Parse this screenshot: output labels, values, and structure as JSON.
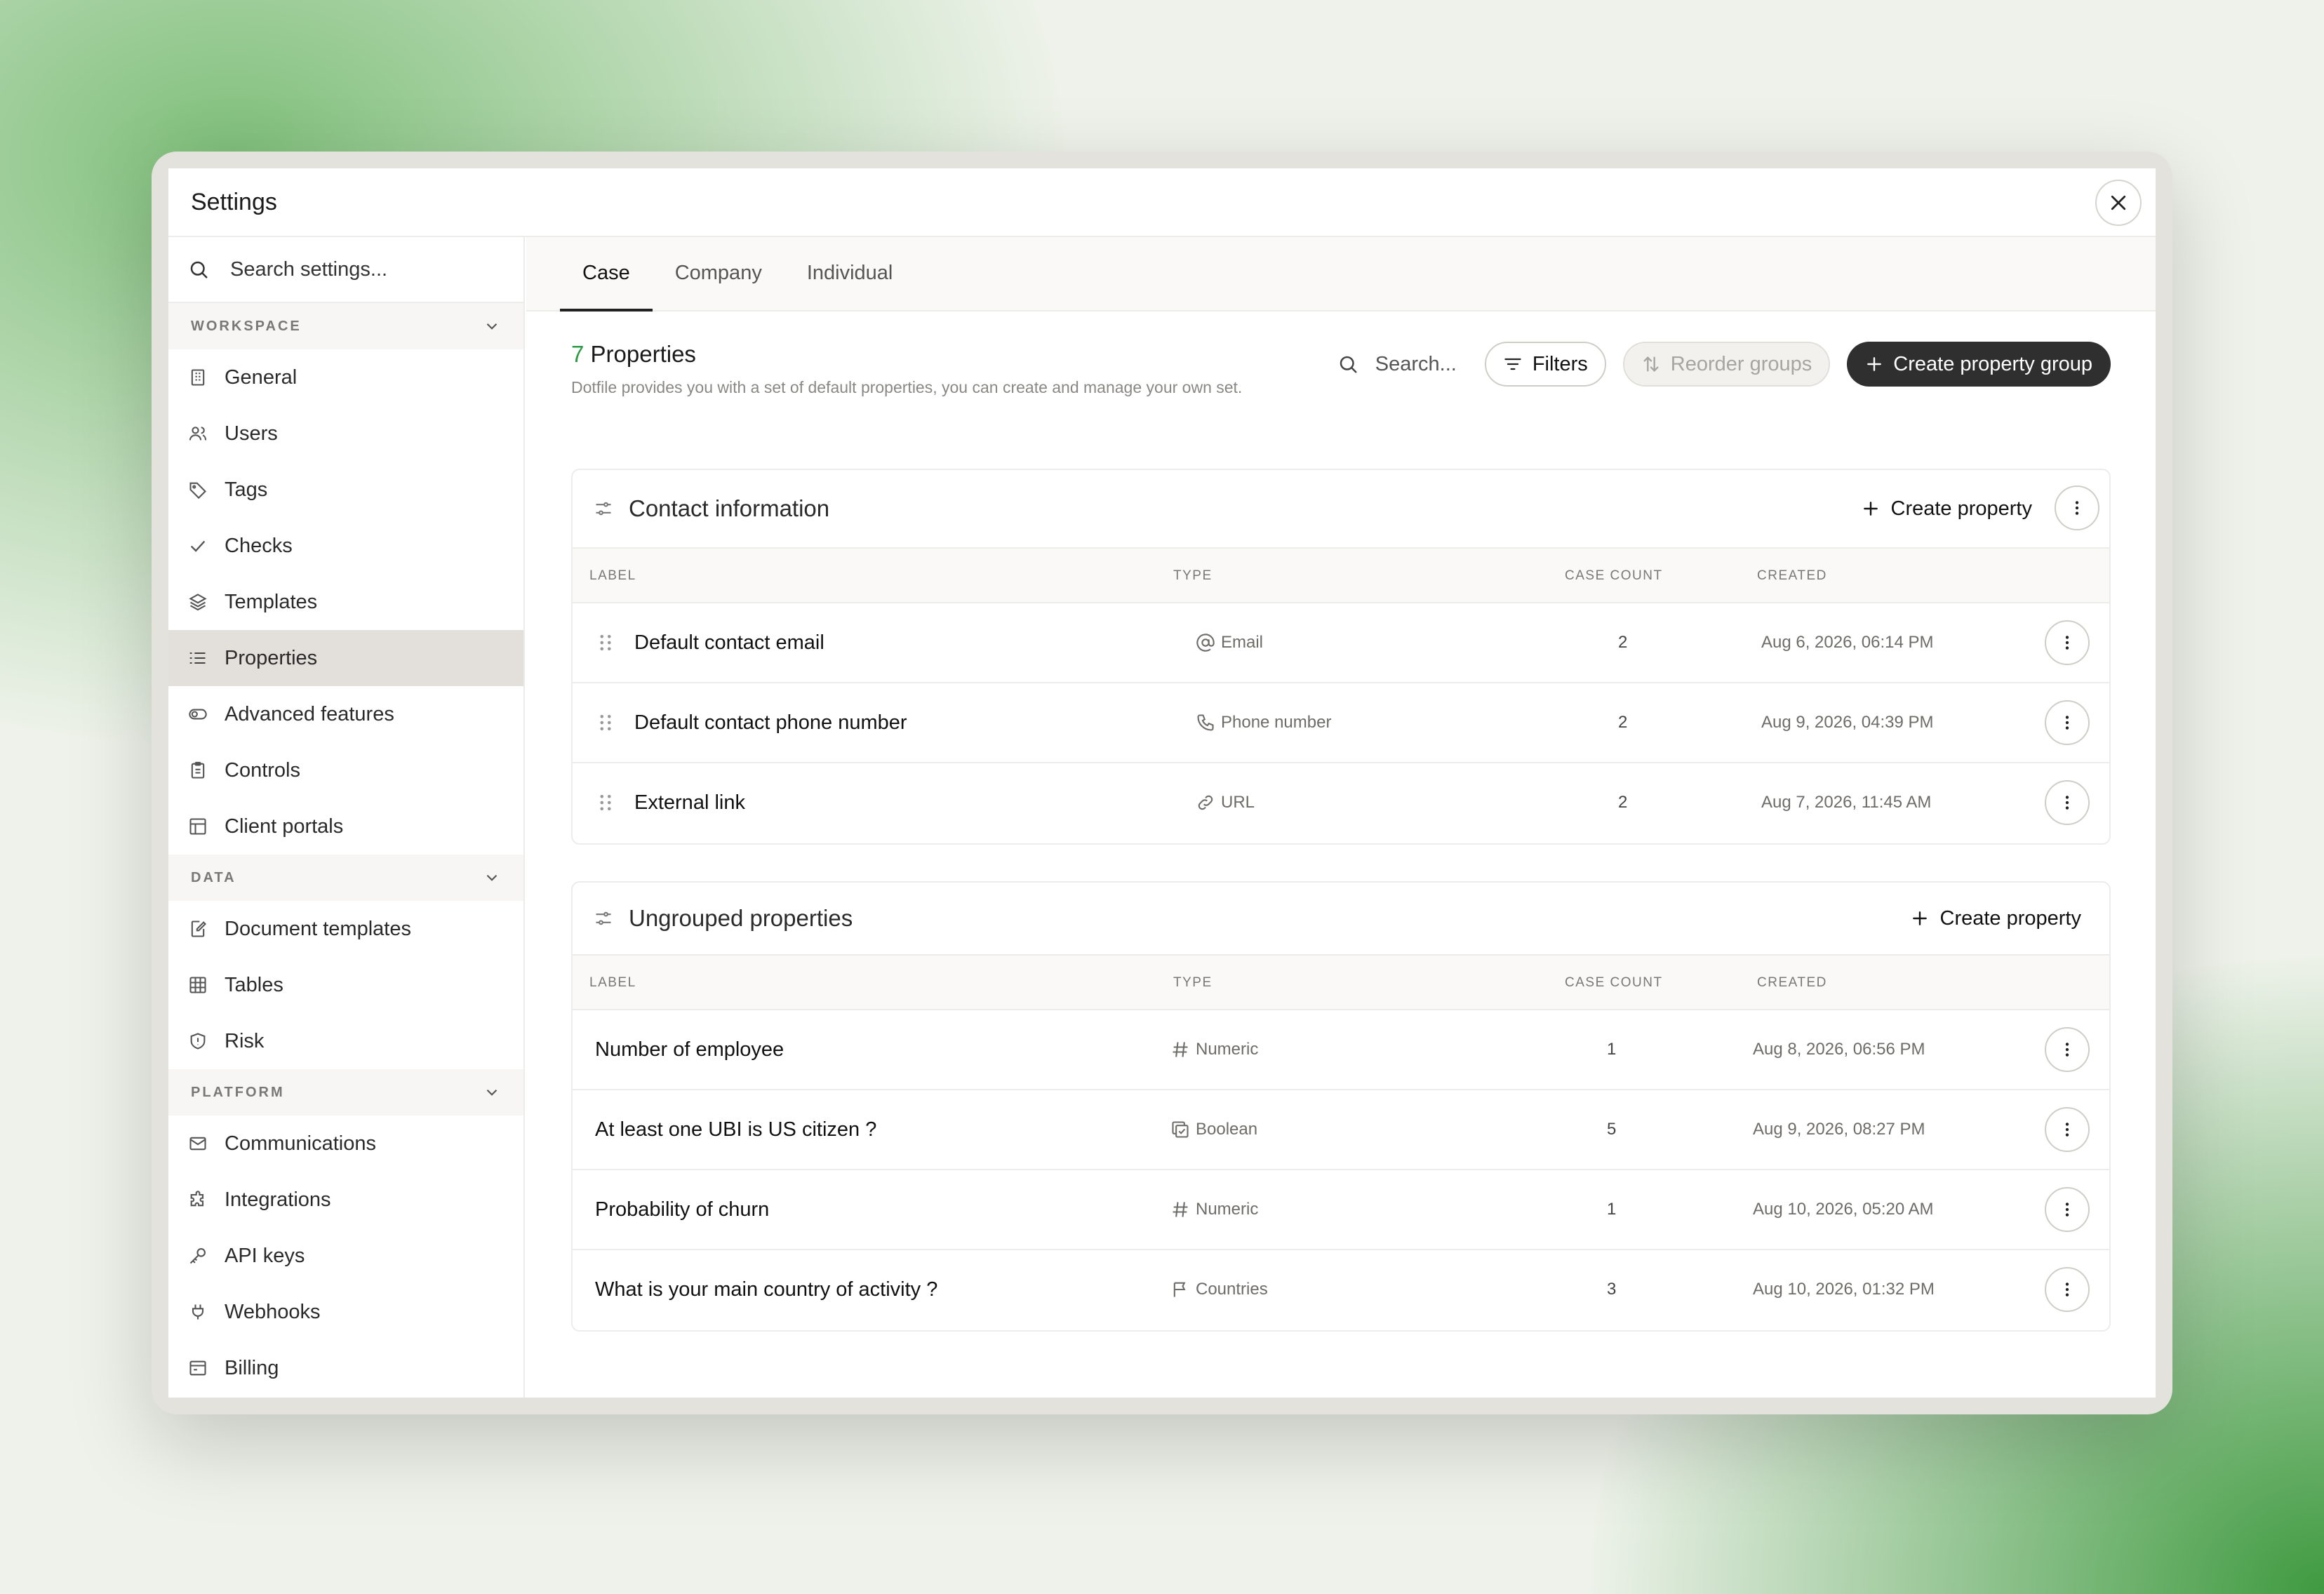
{
  "window": {
    "title": "Settings"
  },
  "sidebar": {
    "search_placeholder": "Search settings...",
    "sections": [
      {
        "title": "WORKSPACE",
        "items": [
          "General",
          "Users",
          "Tags",
          "Checks",
          "Templates",
          "Properties",
          "Advanced features",
          "Controls",
          "Client portals"
        ]
      },
      {
        "title": "DATA",
        "items": [
          "Document templates",
          "Tables",
          "Risk"
        ]
      },
      {
        "title": "PLATFORM",
        "items": [
          "Communications",
          "Integrations",
          "API keys",
          "Webhooks",
          "Billing"
        ]
      }
    ],
    "active_item": "Properties"
  },
  "tabs": [
    "Case",
    "Company",
    "Individual"
  ],
  "active_tab": "Case",
  "header": {
    "count": "7",
    "count_label": "Properties",
    "description": "Dotfile provides you with a set of default properties, you can create and manage your own set.",
    "search_label": "Search...",
    "filters_label": "Filters",
    "reorder_label": "Reorder groups",
    "create_group_label": "Create property group"
  },
  "columns": {
    "label": "LABEL",
    "type": "TYPE",
    "case_count": "CASE COUNT",
    "created": "CREATED"
  },
  "groups": [
    {
      "title": "Contact information",
      "create_label": "Create property",
      "rows": [
        {
          "label": "Default contact email",
          "type": "Email",
          "type_icon": "at-icon",
          "count": "2",
          "created": "Aug 6, 2026, 06:14 PM"
        },
        {
          "label": "Default contact phone number",
          "type": "Phone number",
          "type_icon": "phone-icon",
          "count": "2",
          "created": "Aug 9, 2026, 04:39 PM"
        },
        {
          "label": "External link",
          "type": "URL",
          "type_icon": "link-icon",
          "count": "2",
          "created": "Aug 7, 2026, 11:45 AM"
        }
      ]
    },
    {
      "title": "Ungrouped properties",
      "create_label": "Create property",
      "rows": [
        {
          "label": "Number of employee",
          "type": "Numeric",
          "type_icon": "hash-icon",
          "count": "1",
          "created": "Aug 8, 2026, 06:56 PM"
        },
        {
          "label": "At least one UBI is US citizen ?",
          "type": "Boolean",
          "type_icon": "boolean-icon",
          "count": "5",
          "created": "Aug 9, 2026, 08:27 PM"
        },
        {
          "label": "Probability of churn",
          "type": "Numeric",
          "type_icon": "hash-icon",
          "count": "1",
          "created": "Aug 10, 2026, 05:20 AM"
        },
        {
          "label": "What is your main country of activity ?",
          "type": "Countries",
          "type_icon": "flag-icon",
          "count": "3",
          "created": "Aug 10, 2026, 01:32 PM"
        }
      ]
    }
  ],
  "colors": {
    "accent_green": "#2e9a46",
    "dark_button": "#2f2f2f",
    "active_nav": "#e3e0db"
  }
}
